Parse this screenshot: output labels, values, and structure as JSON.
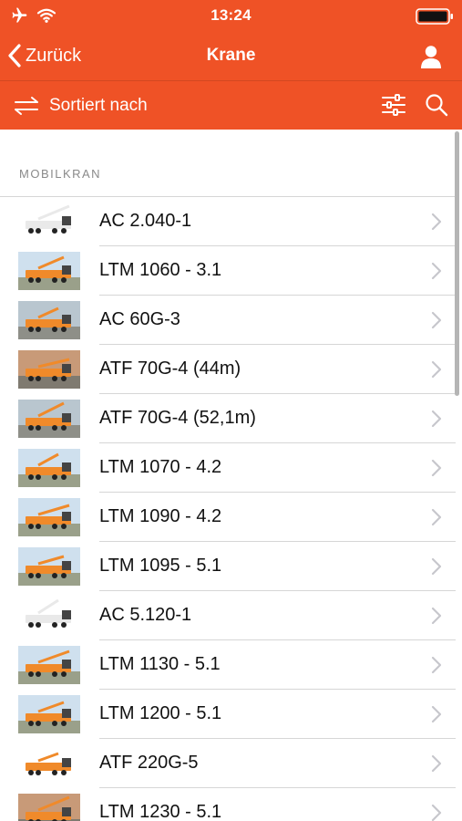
{
  "status": {
    "time": "13:24"
  },
  "nav": {
    "back_label": "Zurück",
    "title": "Krane"
  },
  "toolbar": {
    "sort_label": "Sortiert nach"
  },
  "section": {
    "header": "MOBILKRAN"
  },
  "items": [
    {
      "label": "AC 2.040-1",
      "scene": "white"
    },
    {
      "label": "LTM 1060 - 3.1",
      "scene": "sky"
    },
    {
      "label": "AC 60G-3",
      "scene": "street"
    },
    {
      "label": "ATF 70G-4 (44m)",
      "scene": "autumn"
    },
    {
      "label": "ATF 70G-4 (52,1m)",
      "scene": "street"
    },
    {
      "label": "LTM 1070 - 4.2",
      "scene": "sky"
    },
    {
      "label": "LTM 1090 - 4.2",
      "scene": "sky"
    },
    {
      "label": "LTM 1095 - 5.1",
      "scene": "sky"
    },
    {
      "label": "AC 5.120-1",
      "scene": "white"
    },
    {
      "label": "LTM 1130 - 5.1",
      "scene": "sky"
    },
    {
      "label": "LTM 1200 - 5.1",
      "scene": "sky"
    },
    {
      "label": "ATF 220G-5",
      "scene": "white"
    },
    {
      "label": "LTM 1230 - 5.1",
      "scene": "autumn"
    }
  ],
  "colors": {
    "brand": "#ef5226",
    "separator": "#d6d6d6",
    "chevron": "#c7c7cc",
    "section_text": "#8a8a8a"
  },
  "icons": {
    "status": [
      "airplane-icon",
      "wifi-icon",
      "battery-icon"
    ],
    "nav": [
      "chevron-left-icon",
      "user-icon"
    ],
    "toolbar": [
      "sort-arrows-icon",
      "sliders-icon",
      "search-icon"
    ],
    "row": [
      "crane-thumbnail",
      "chevron-right-icon"
    ]
  }
}
